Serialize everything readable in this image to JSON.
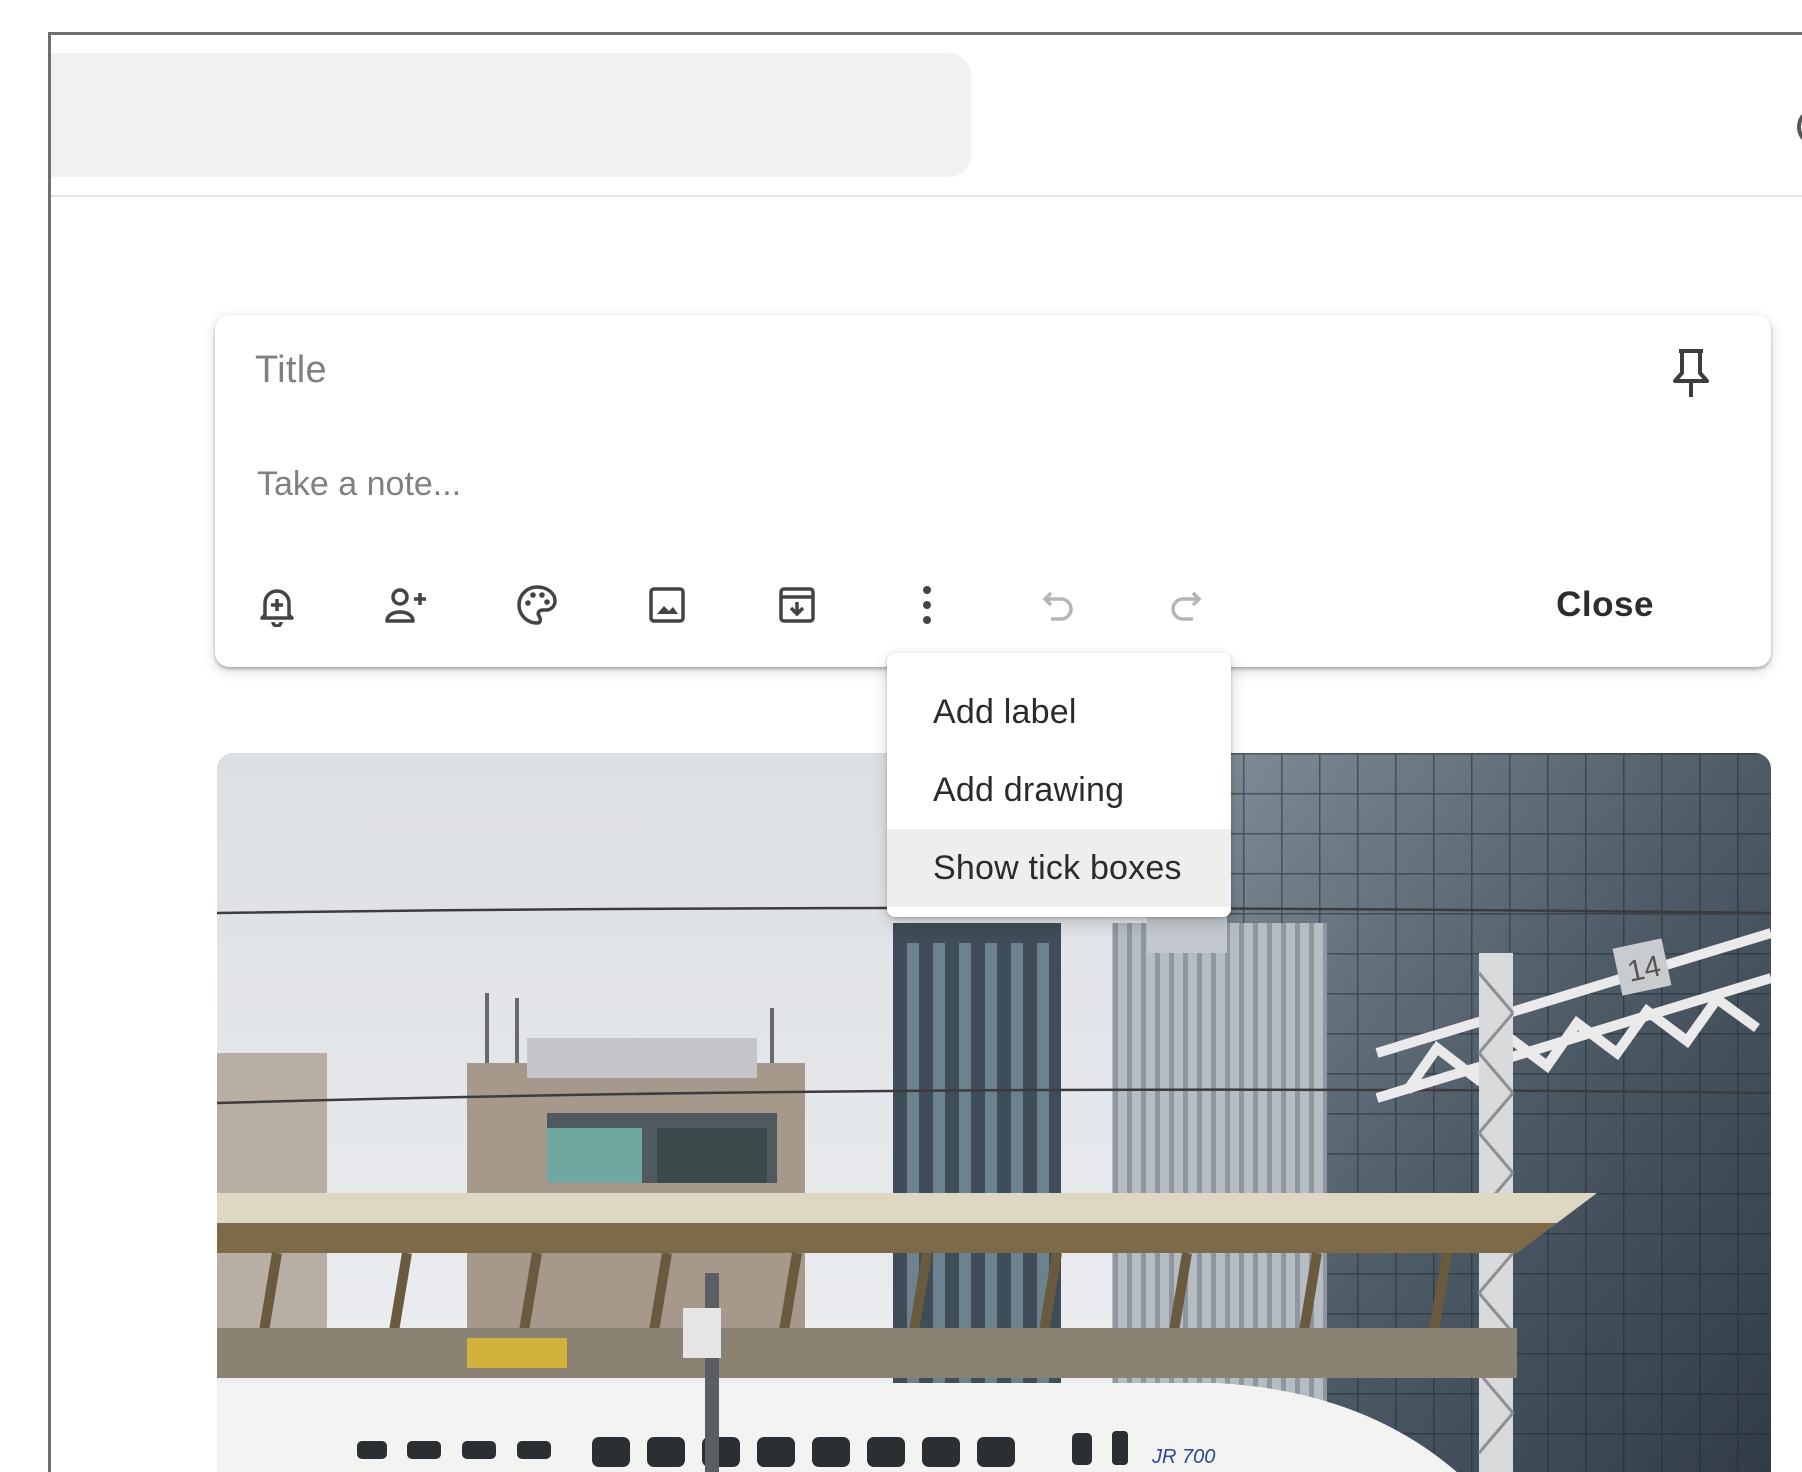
{
  "note": {
    "title_placeholder": "Title",
    "body_placeholder": "Take a note...",
    "close_label": "Close"
  },
  "toolbar": {
    "icons": [
      "bell-plus-icon",
      "person-add-icon",
      "palette-icon",
      "image-icon",
      "archive-icon",
      "more-vert-icon",
      "undo-icon",
      "redo-icon"
    ],
    "disabled": [
      "undo-icon",
      "redo-icon"
    ]
  },
  "menu": {
    "items": [
      {
        "label": "Add label"
      },
      {
        "label": "Add drawing"
      },
      {
        "label": "Show tick boxes"
      }
    ],
    "hovered": "Show tick boxes"
  },
  "photo": {
    "train_marking": "JR 700",
    "signboard_number": "14"
  },
  "colors": {
    "icon": "#444444",
    "icon_disabled": "#b5b5b5",
    "menu_hover": "#eeeeee",
    "search_bg": "#f1f1f1"
  }
}
